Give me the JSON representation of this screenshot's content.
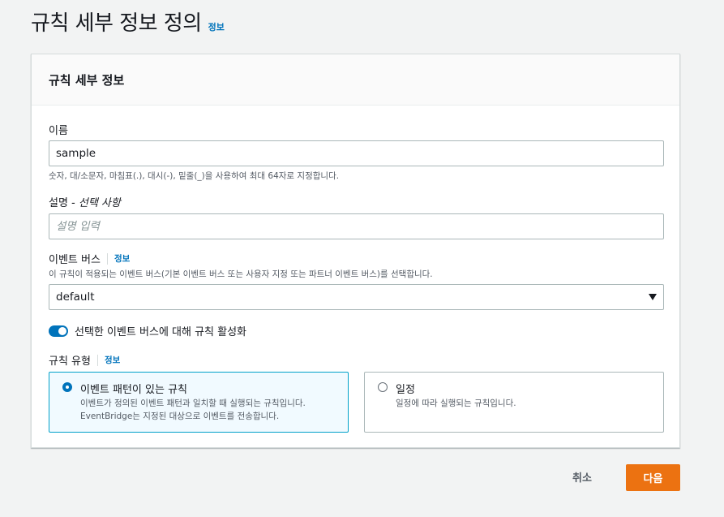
{
  "page": {
    "title": "규칙 세부 정보 정의",
    "info_link": "정보"
  },
  "card": {
    "header": "규칙 세부 정보",
    "name": {
      "label": "이름",
      "value": "sample",
      "hint": "숫자, 대/소문자, 마침표(.), 대시(-), 밑줄(_)을 사용하여 최대 64자로 지정합니다."
    },
    "description": {
      "label": "설명",
      "optional": " - 선택 사항",
      "placeholder": "설명 입력"
    },
    "event_bus": {
      "label": "이벤트 버스",
      "info": "정보",
      "hint": "이 규칙이 적용되는 이벤트 버스(기본 이벤트 버스 또는 사용자 지정 또는 파트너 이벤트 버스)를 선택합니다.",
      "selected": "default"
    },
    "toggle": {
      "label": "선택한 이벤트 버스에 대해 규칙 활성화",
      "enabled": true
    },
    "rule_type": {
      "label": "규칙 유형",
      "info": "정보",
      "options": [
        {
          "title": "이벤트 패턴이 있는 규칙",
          "desc_line1": "이벤트가 정의된 이벤트 패턴과 일치할 때 실행되는 규칙입니다.",
          "desc_line2": "EventBridge는 지정된 대상으로 이벤트를 전송합니다.",
          "selected": true
        },
        {
          "title": "일정",
          "desc_line1": "일정에 따라 실행되는 규칙입니다.",
          "selected": false
        }
      ]
    }
  },
  "footer": {
    "cancel": "취소",
    "next": "다음"
  },
  "colors": {
    "primary_button": "#ec7211",
    "link": "#0073bb",
    "selected_tile_bg": "#f1faff",
    "selected_tile_border": "#00a1c9"
  }
}
